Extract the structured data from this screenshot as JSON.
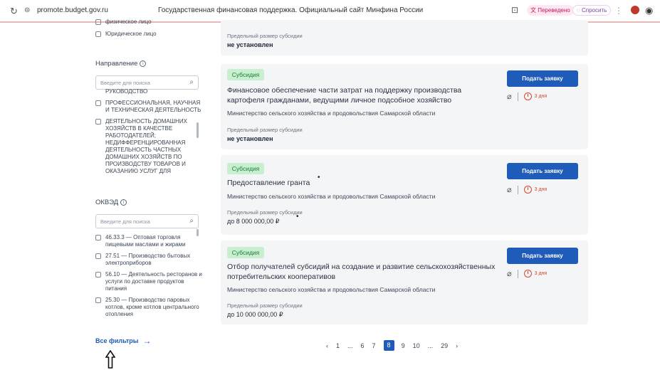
{
  "browser": {
    "url": "promote.budget.gov.ru",
    "title": "Государственная финансовая поддержка. Официальный сайт Минфина России",
    "translated": "Переведено",
    "ask": "Спросить"
  },
  "sidebar": {
    "top_items": [
      "физическое лицо",
      "Юридическое лицо"
    ],
    "direction": {
      "title": "Направление",
      "search_placeholder": "Введите для поиска",
      "items": [
        "РУКОВОДСТВО",
        "ПРОФЕССИОНАЛЬНАЯ, НАУЧНАЯ И ТЕХНИЧЕСКАЯ ДЕЯТЕЛЬНОСТЬ",
        "ДЕЯТЕЛЬНОСТЬ ДОМАШНИХ ХОЗЯЙСТВ В КАЧЕСТВЕ РАБОТОДАТЕЛЕЙ; НЕДИФФЕРЕНЦИРОВАННАЯ ДЕЯТЕЛЬНОСТЬ ЧАСТНЫХ ДОМАШНИХ ХОЗЯЙСТВ ПО ПРОИЗВОДСТВУ ТОВАРОВ И ОКАЗАНИЮ УСЛУГ ДЛЯ"
      ]
    },
    "okved": {
      "title": "ОКВЭД",
      "search_placeholder": "Введите для поиска",
      "items": [
        "46.33.3 — Оптовая торговля пищевыми маслами и жирами",
        "27.51 — Производство бытовых электроприборов",
        "56.10 — Деятельность ресторанов и услуги по доставке продуктов питания",
        "25.30 — Производство паровых котлов, кроме котлов центрального отопления"
      ]
    },
    "all_filters": "Все фильтры"
  },
  "cards": {
    "top": {
      "label": "Предельный размер субсидии",
      "value": "не установлен"
    },
    "list": [
      {
        "badge": "Субсидия",
        "title": "Финансовое обеспечение части затрат на поддержку производства картофеля гражданами, ведущими личное подсобное хозяйство",
        "org": "Министерство сельского хозяйства и продовольствия Самарской области",
        "limit_label": "Предельный размер субсидии",
        "limit_value": "не установлен",
        "button": "Подать заявку",
        "days": "3 дня"
      },
      {
        "badge": "Субсидия",
        "title": "Предоставление гранта",
        "org": "Министерство сельского хозяйства и продовольствия Самарской области",
        "limit_label": "Предельный размер субсидии",
        "limit_value": "до 8 000 000,00 ₽",
        "button": "Подать заявку",
        "days": "3 дня"
      },
      {
        "badge": "Субсидия",
        "title": "Отбор получателей субсидий на создание и развитие сельскохозяйственных потребительских кооперативов",
        "org": "Министерство сельского хозяйства и продовольствия Самарской области",
        "limit_label": "Предельный размер субсидии",
        "limit_value": "до 10 000 000,00 ₽",
        "button": "Подать заявку",
        "days": "3 дня"
      }
    ]
  },
  "pagination": {
    "prev": "‹",
    "pages": [
      "1",
      "...",
      "6",
      "7",
      "8",
      "9",
      "10",
      "...",
      "29"
    ],
    "active": "8",
    "next": "›"
  },
  "colors": {
    "accent": "#1f5bb8",
    "badge_bg": "#c8efcf",
    "badge_text": "#1f7a35",
    "deadline": "#d9452b"
  }
}
